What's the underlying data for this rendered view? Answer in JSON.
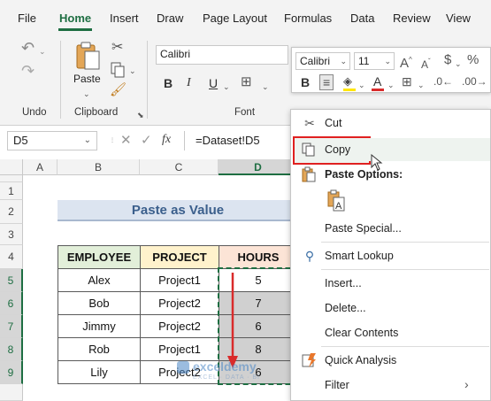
{
  "menu": {
    "tabs": [
      "File",
      "Home",
      "Insert",
      "Draw",
      "Page Layout",
      "Formulas",
      "Data",
      "Review",
      "View"
    ]
  },
  "ribbon": {
    "undo_label": "Undo",
    "clipboard_label": "Clipboard",
    "paste_label": "Paste",
    "font_label": "Font",
    "font_name": "Calibri"
  },
  "formula_bar": {
    "name_box": "D5",
    "fx": "fx",
    "formula": "=Dataset!D5"
  },
  "mini_toolbar": {
    "font_name": "Calibri",
    "font_size": "11"
  },
  "sheet": {
    "columns": [
      "A",
      "B",
      "C",
      "D"
    ],
    "rows": [
      "1",
      "2",
      "3",
      "4",
      "5",
      "6",
      "7",
      "8",
      "9"
    ],
    "title": "Paste as Value",
    "headers": [
      "EMPLOYEE",
      "PROJECT",
      "HOURS"
    ],
    "data": [
      [
        "Alex",
        "Project1",
        "5"
      ],
      [
        "Bob",
        "Project2",
        "7"
      ],
      [
        "Jimmy",
        "Project2",
        "6"
      ],
      [
        "Rob",
        "Project1",
        "8"
      ],
      [
        "Lily",
        "Project2",
        "6"
      ]
    ],
    "watermark": "exceldemy",
    "watermark_sub": "EXCEL · DATA · BI"
  },
  "context_menu": {
    "cut": "Cut",
    "copy": "Copy",
    "paste_options": "Paste Options:",
    "paste_special": "Paste Special...",
    "smart_lookup": "Smart Lookup",
    "insert": "Insert...",
    "delete": "Delete...",
    "clear_contents": "Clear Contents",
    "quick_analysis": "Quick Analysis",
    "filter": "Filter"
  },
  "colors": {
    "accent_green": "#1e6e42",
    "title_fill": "#dce4f0",
    "title_text": "#3b5f8c",
    "employee_header_fill": "#e2efd9",
    "project_header_fill": "#fff2cc",
    "hours_header_fill": "#fce4d6",
    "selection_fill": "#d0d0d0",
    "highlight_red": "#d92b2b"
  }
}
